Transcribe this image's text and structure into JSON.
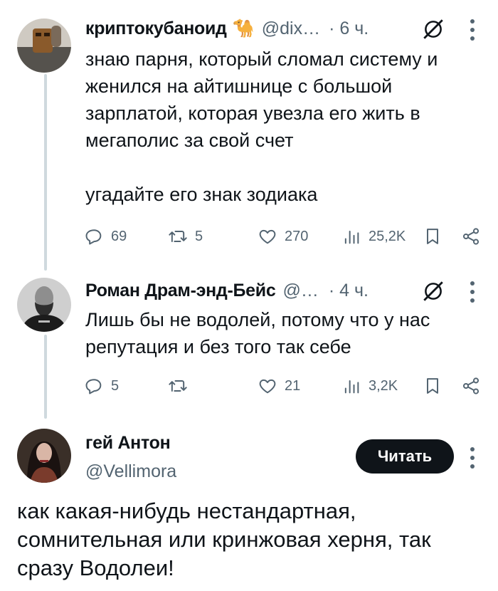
{
  "tweets": [
    {
      "name": "криптокубаноид",
      "emoji": "🐪",
      "handle": "@dix…",
      "time": "· 6 ч.",
      "text": "знаю парня, который сломал систему и\nженился на айтишнице с большой\nзарплатой, которая увезла его жить в\nмегаполис за свой счет\n\nугадайте его знак зодиака",
      "replies": "69",
      "retweets": "5",
      "likes": "270",
      "views": "25,2K"
    },
    {
      "name": "Роман Драм-энд-Бейс",
      "handle": "@…",
      "time": "· 4 ч.",
      "text": "Лишь бы не водолей, потому что у нас\nрепутация и без того так себе",
      "replies": "5",
      "retweets": "",
      "likes": "21",
      "views": "3,2K"
    }
  ],
  "main_tweet": {
    "name": "гей Антон",
    "handle": "@Vellimora",
    "follow_label": "Читать",
    "text": "как какая-нибудь нестандартная, сомнительная или кринжовая херня, так сразу Водолеи!"
  },
  "colors": {
    "text": "#0f1419",
    "secondary": "#536471",
    "thread_line": "#cfd9de",
    "button_bg": "#0f1419"
  },
  "icons": [
    "reply-icon",
    "retweet-icon",
    "like-icon",
    "views-icon",
    "bookmark-icon",
    "share-icon",
    "grok-icon",
    "more-icon"
  ]
}
